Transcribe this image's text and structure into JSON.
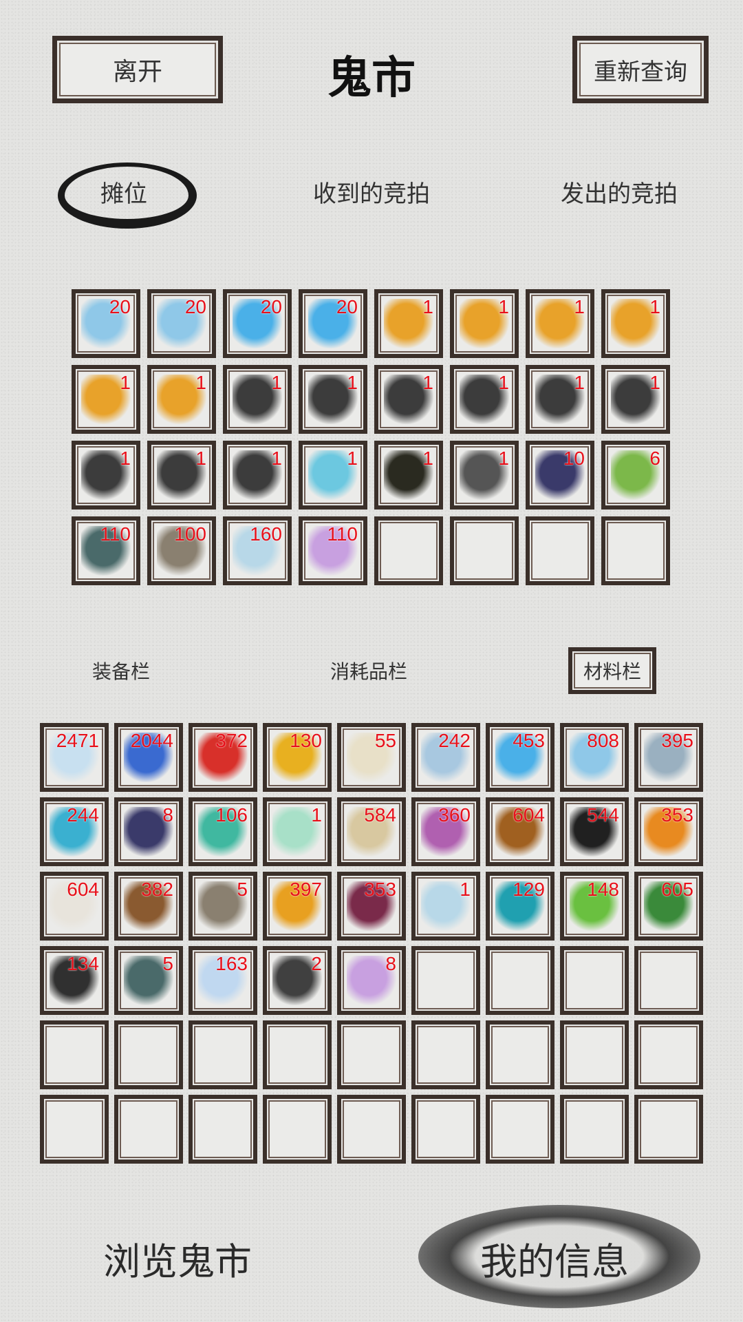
{
  "header": {
    "leave_label": "离开",
    "title": "鬼市",
    "requery_label": "重新查询"
  },
  "tabs": [
    {
      "label": "摊位",
      "active": true
    },
    {
      "label": "收到的竞拍",
      "active": false
    },
    {
      "label": "发出的竞拍",
      "active": false
    }
  ],
  "stall_slots": [
    {
      "icon": "water-orb-icon",
      "qty": "20",
      "color": "#8fc8e8"
    },
    {
      "icon": "water-orb-icon",
      "qty": "20",
      "color": "#8fc8e8"
    },
    {
      "icon": "ice-crystal-icon",
      "qty": "20",
      "color": "#4ab0e8"
    },
    {
      "icon": "ice-crystal-icon",
      "qty": "20",
      "color": "#4ab0e8"
    },
    {
      "icon": "scroll-icon",
      "qty": "1",
      "color": "#e8a22a"
    },
    {
      "icon": "scroll-icon",
      "qty": "1",
      "color": "#e8a22a"
    },
    {
      "icon": "scroll-icon",
      "qty": "1",
      "color": "#e8a22a"
    },
    {
      "icon": "scroll-icon",
      "qty": "1",
      "color": "#e8a22a"
    },
    {
      "icon": "scroll-icon",
      "qty": "1",
      "color": "#e8a22a"
    },
    {
      "icon": "scroll-icon",
      "qty": "1",
      "color": "#e8a22a"
    },
    {
      "icon": "book-icon",
      "qty": "1",
      "color": "#3c3c3c"
    },
    {
      "icon": "book-icon",
      "qty": "1",
      "color": "#3c3c3c"
    },
    {
      "icon": "book-icon",
      "qty": "1",
      "color": "#3c3c3c"
    },
    {
      "icon": "book-icon",
      "qty": "1",
      "color": "#3c3c3c"
    },
    {
      "icon": "book-icon",
      "qty": "1",
      "color": "#3c3c3c"
    },
    {
      "icon": "book-icon",
      "qty": "1",
      "color": "#3c3c3c"
    },
    {
      "icon": "book-icon",
      "qty": "1",
      "color": "#3c3c3c"
    },
    {
      "icon": "book-icon",
      "qty": "1",
      "color": "#3c3c3c"
    },
    {
      "icon": "book-icon",
      "qty": "1",
      "color": "#3c3c3c"
    },
    {
      "icon": "sword-icon",
      "qty": "1",
      "color": "#6cc8e0"
    },
    {
      "icon": "armor-icon",
      "qty": "1",
      "color": "#2a2a20"
    },
    {
      "icon": "boots-icon",
      "qty": "1",
      "color": "#555555"
    },
    {
      "icon": "berry-icon",
      "qty": "10",
      "color": "#3a3a6a"
    },
    {
      "icon": "cabbage-icon",
      "qty": "6",
      "color": "#7cb84a"
    },
    {
      "icon": "herb-stone-icon",
      "qty": "110",
      "color": "#4a6a6a"
    },
    {
      "icon": "wood-icon",
      "qty": "100",
      "color": "#8a8070"
    },
    {
      "icon": "whirlwind-icon",
      "qty": "160",
      "color": "#b8d8e8"
    },
    {
      "icon": "feather-icon",
      "qty": "110",
      "color": "#c8a0e0"
    },
    {
      "icon": "",
      "qty": "",
      "color": ""
    },
    {
      "icon": "",
      "qty": "",
      "color": ""
    },
    {
      "icon": "",
      "qty": "",
      "color": ""
    },
    {
      "icon": "",
      "qty": "",
      "color": ""
    }
  ],
  "categories": [
    {
      "label": "装备栏",
      "active": false
    },
    {
      "label": "消耗品栏",
      "active": false
    },
    {
      "label": "材料栏",
      "active": true
    }
  ],
  "bag_slots": [
    {
      "icon": "ice-shard-icon",
      "qty": "2471",
      "color": "#c8e0f0"
    },
    {
      "icon": "sapphire-icon",
      "qty": "2044",
      "color": "#3a6ad0"
    },
    {
      "icon": "ruby-icon",
      "qty": "372",
      "color": "#d8302a"
    },
    {
      "icon": "sunflower-icon",
      "qty": "130",
      "color": "#e8b020"
    },
    {
      "icon": "cotton-flower-icon",
      "qty": "55",
      "color": "#e8e0c8"
    },
    {
      "icon": "ice-flower-icon",
      "qty": "242",
      "color": "#a8c8e0"
    },
    {
      "icon": "ice-crystal-icon",
      "qty": "453",
      "color": "#4ab0e8"
    },
    {
      "icon": "water-orb-icon",
      "qty": "808",
      "color": "#8fc8e8"
    },
    {
      "icon": "silver-ring-icon",
      "qty": "395",
      "color": "#9ab0c0"
    },
    {
      "icon": "blue-block-icon",
      "qty": "244",
      "color": "#3ab0d0"
    },
    {
      "icon": "berry-icon",
      "qty": "8",
      "color": "#3a3a6a"
    },
    {
      "icon": "jade-ring-icon",
      "qty": "106",
      "color": "#40b8a0"
    },
    {
      "icon": "green-crystal-icon",
      "qty": "1",
      "color": "#a8e0c8"
    },
    {
      "icon": "spotted-egg-icon",
      "qty": "584",
      "color": "#d8c8a0"
    },
    {
      "icon": "purple-ribbon-icon",
      "qty": "360",
      "color": "#b060b0"
    },
    {
      "icon": "campfire-icon",
      "qty": "604",
      "color": "#a06020"
    },
    {
      "icon": "black-disc-icon",
      "qty": "544",
      "color": "#202020"
    },
    {
      "icon": "pumpkin-icon",
      "qty": "353",
      "color": "#e88a20"
    },
    {
      "icon": "cloud-icon",
      "qty": "604",
      "color": "#e8e4dc"
    },
    {
      "icon": "brown-leaf-icon",
      "qty": "382",
      "color": "#8a5a30"
    },
    {
      "icon": "wood-icon",
      "qty": "5",
      "color": "#8a8070"
    },
    {
      "icon": "gold-block-icon",
      "qty": "397",
      "color": "#e8a020"
    },
    {
      "icon": "dark-crystal-icon",
      "qty": "353",
      "color": "#7a2a4a"
    },
    {
      "icon": "whirlwind-icon",
      "qty": "1",
      "color": "#b8d8e8"
    },
    {
      "icon": "teal-drop-icon",
      "qty": "129",
      "color": "#20a0b0"
    },
    {
      "icon": "green-leaf-icon",
      "qty": "148",
      "color": "#6ac040"
    },
    {
      "icon": "sprig-icon",
      "qty": "605",
      "color": "#3a8a3a"
    },
    {
      "icon": "black-flower-icon",
      "qty": "134",
      "color": "#303030"
    },
    {
      "icon": "herb-stone-icon",
      "qty": "5",
      "color": "#4a6a6a"
    },
    {
      "icon": "pearl-icon",
      "qty": "163",
      "color": "#c0d8f0"
    },
    {
      "icon": "black-flame-icon",
      "qty": "2",
      "color": "#404040"
    },
    {
      "icon": "feather-icon",
      "qty": "8",
      "color": "#c8a0e0"
    },
    {
      "icon": "",
      "qty": "",
      "color": ""
    },
    {
      "icon": "",
      "qty": "",
      "color": ""
    },
    {
      "icon": "",
      "qty": "",
      "color": ""
    },
    {
      "icon": "",
      "qty": "",
      "color": ""
    },
    {
      "icon": "",
      "qty": "",
      "color": ""
    },
    {
      "icon": "",
      "qty": "",
      "color": ""
    },
    {
      "icon": "",
      "qty": "",
      "color": ""
    },
    {
      "icon": "",
      "qty": "",
      "color": ""
    },
    {
      "icon": "",
      "qty": "",
      "color": ""
    },
    {
      "icon": "",
      "qty": "",
      "color": ""
    },
    {
      "icon": "",
      "qty": "",
      "color": ""
    },
    {
      "icon": "",
      "qty": "",
      "color": ""
    },
    {
      "icon": "",
      "qty": "",
      "color": ""
    },
    {
      "icon": "",
      "qty": "",
      "color": ""
    },
    {
      "icon": "",
      "qty": "",
      "color": ""
    },
    {
      "icon": "",
      "qty": "",
      "color": ""
    },
    {
      "icon": "",
      "qty": "",
      "color": ""
    },
    {
      "icon": "",
      "qty": "",
      "color": ""
    },
    {
      "icon": "",
      "qty": "",
      "color": ""
    },
    {
      "icon": "",
      "qty": "",
      "color": ""
    },
    {
      "icon": "",
      "qty": "",
      "color": ""
    },
    {
      "icon": "",
      "qty": "",
      "color": ""
    }
  ],
  "bottom_nav": {
    "browse_label": "浏览鬼市",
    "my_info_label": "我的信息"
  }
}
